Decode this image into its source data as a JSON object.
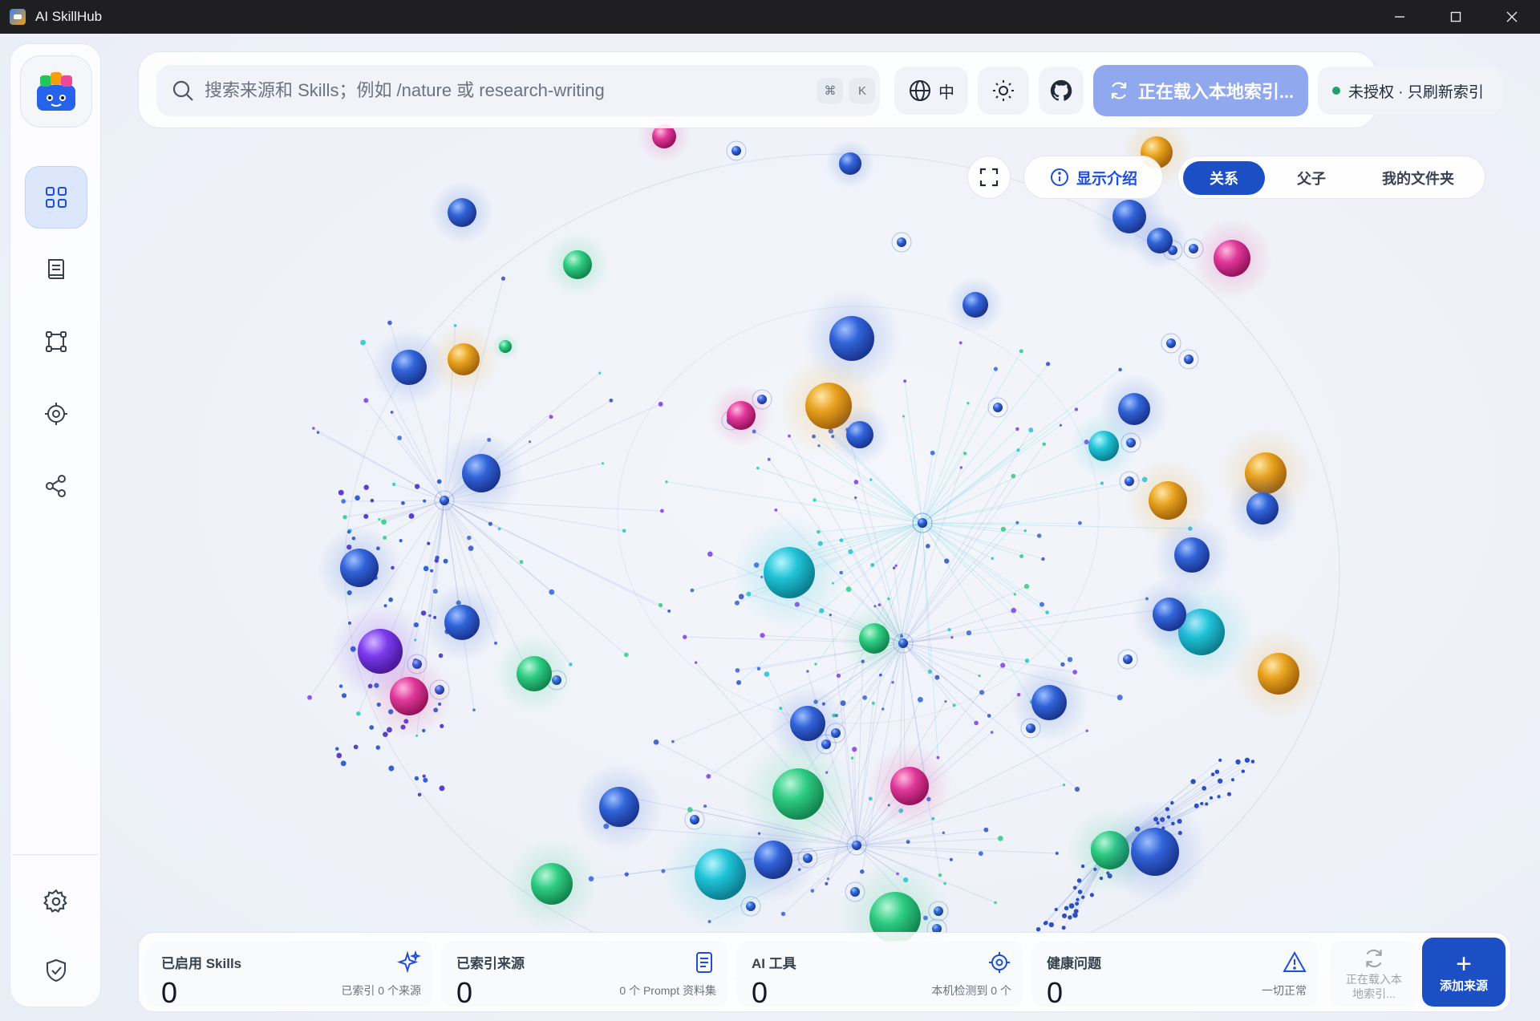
{
  "window": {
    "title": "AI SkillHub"
  },
  "search": {
    "placeholder": "搜索来源和 Skills；例如 /nature 或 research-writing",
    "kbd_cmd": "⌘",
    "kbd_key": "K"
  },
  "toolbar": {
    "language_label": "中",
    "loading_label": "正在载入本地索引...",
    "auth_status": "未授权 · 只刷新索引"
  },
  "view": {
    "intro_label": "显示介绍",
    "tabs": [
      {
        "label": "关系",
        "active": true
      },
      {
        "label": "父子",
        "active": false
      },
      {
        "label": "我的文件夹",
        "active": false
      }
    ]
  },
  "sidebar": {
    "items": [
      {
        "name": "dashboard-icon",
        "active": true
      },
      {
        "name": "book-icon",
        "active": false
      },
      {
        "name": "graph-icon",
        "active": false
      },
      {
        "name": "target-icon",
        "active": false
      },
      {
        "name": "share-icon",
        "active": false
      }
    ],
    "bottom": [
      {
        "name": "settings-icon"
      },
      {
        "name": "shield-check-icon"
      }
    ]
  },
  "stats": [
    {
      "label": "已启用 Skills",
      "value": "0",
      "sub": "已索引 0 个来源",
      "icon": "sparkle-icon"
    },
    {
      "label": "已索引来源",
      "value": "0",
      "sub": "0 个 Prompt 资料集",
      "icon": "document-icon"
    },
    {
      "label": "AI 工具",
      "value": "0",
      "sub": "本机检测到 0 个",
      "icon": "target-icon"
    },
    {
      "label": "健康问题",
      "value": "0",
      "sub": "一切正常",
      "icon": "warning-icon"
    }
  ],
  "stats_actions": {
    "loading_line1": "正在载入本",
    "loading_line2": "地索引...",
    "add_label": "添加来源"
  },
  "colors": {
    "accent": "#1d4fc4",
    "loading_button": "#8fa8ee",
    "node_blue": "#3163d8",
    "node_cyan": "#1fc3d6",
    "node_green": "#2ecc84",
    "node_gold": "#e8a21f",
    "node_pink": "#e0389a",
    "node_purple": "#7c3aed"
  }
}
